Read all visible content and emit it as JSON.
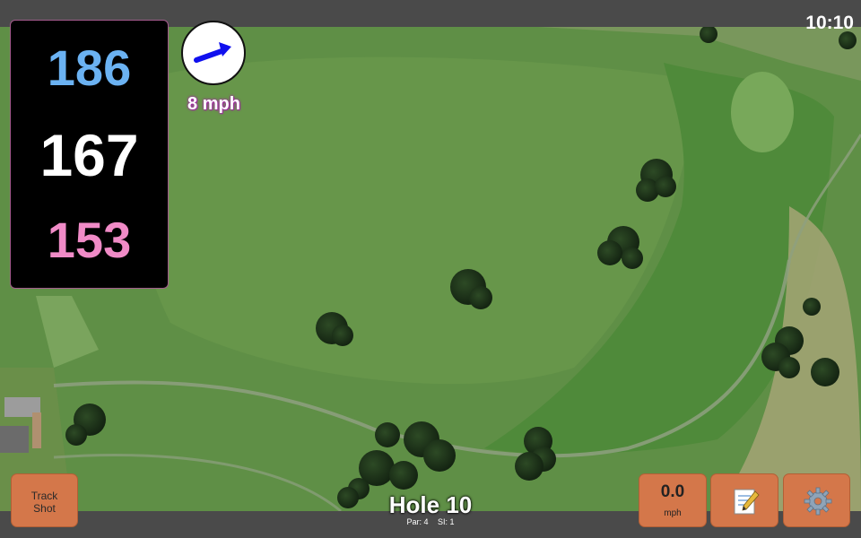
{
  "status_bar": {
    "time": "10:10"
  },
  "yardages": {
    "back": "186",
    "center": "167",
    "front": "153"
  },
  "wind": {
    "speed_label": "8 mph",
    "direction_icon": "arrow-icon"
  },
  "buttons": {
    "track_shot_line1": "Track",
    "track_shot_line2": "Shot",
    "speed_value": "0.0",
    "speed_unit": "mph",
    "notes_icon": "memo-icon",
    "settings_icon": "gear-icon"
  },
  "hole": {
    "title": "Hole 10",
    "par": "Par: 4",
    "si": "SI: 1"
  },
  "colors": {
    "back": "#6bb2f2",
    "center": "#ffffff",
    "front": "#f08bc7",
    "button": "#d4774a",
    "wind_arrow": "#1010ee"
  }
}
